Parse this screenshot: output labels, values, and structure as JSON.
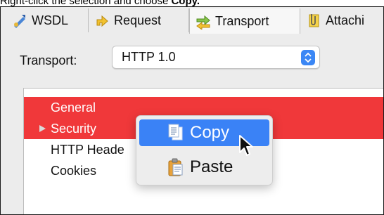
{
  "caption": {
    "text": "Right-click the selection and choose ",
    "bold": "Copy."
  },
  "tabs": [
    {
      "label": "WSDL",
      "icon": "wsdl-icon"
    },
    {
      "label": "Request",
      "icon": "request-icon"
    },
    {
      "label": "Transport",
      "icon": "transport-icon",
      "active": true
    },
    {
      "label": "Attachi",
      "icon": "attachments-icon"
    }
  ],
  "transport": {
    "label": "Transport:",
    "value": "HTTP 1.0"
  },
  "list": {
    "items": [
      {
        "label": "General",
        "selected": true
      },
      {
        "label": "Security",
        "selected": true,
        "expandable": true
      },
      {
        "label": "HTTP Heade",
        "selected": false
      },
      {
        "label": "Cookies",
        "selected": false
      }
    ]
  },
  "context_menu": {
    "items": [
      {
        "label": "Copy",
        "icon": "copy-icon",
        "highlighted": true
      },
      {
        "label": "Paste",
        "icon": "paste-icon",
        "highlighted": false
      }
    ]
  },
  "colors": {
    "selection": "#f0383a",
    "menu_highlight": "#3a82f6",
    "select_arrow": "#3b87f5"
  }
}
